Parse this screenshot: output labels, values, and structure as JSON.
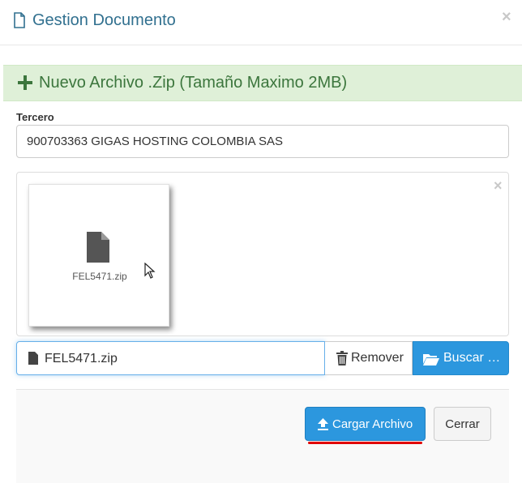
{
  "header": {
    "title": "Gestion Documento",
    "close_symbol": "×",
    "icon": "file-outline-icon"
  },
  "alert": {
    "text": "Nuevo Archivo .Zip (Tamaño Maximo 2MB)",
    "icon": "plus-icon",
    "color": "#3c763d",
    "background": "#dff0d8"
  },
  "form": {
    "tercero_label": "Tercero",
    "tercero_value": "900703363 GIGAS HOSTING COLOMBIA SAS"
  },
  "preview": {
    "close_symbol": "×",
    "file_name": "FEL5471.zip",
    "icon": "file-icon"
  },
  "file_input": {
    "selected_file": "FEL5471.zip",
    "remove_label": "Remover",
    "browse_label": "Buscar …"
  },
  "footer": {
    "upload_label": "Cargar Archivo",
    "close_label": "Cerrar",
    "upload_color": "#2c97de",
    "annotation_color": "#e00000"
  }
}
